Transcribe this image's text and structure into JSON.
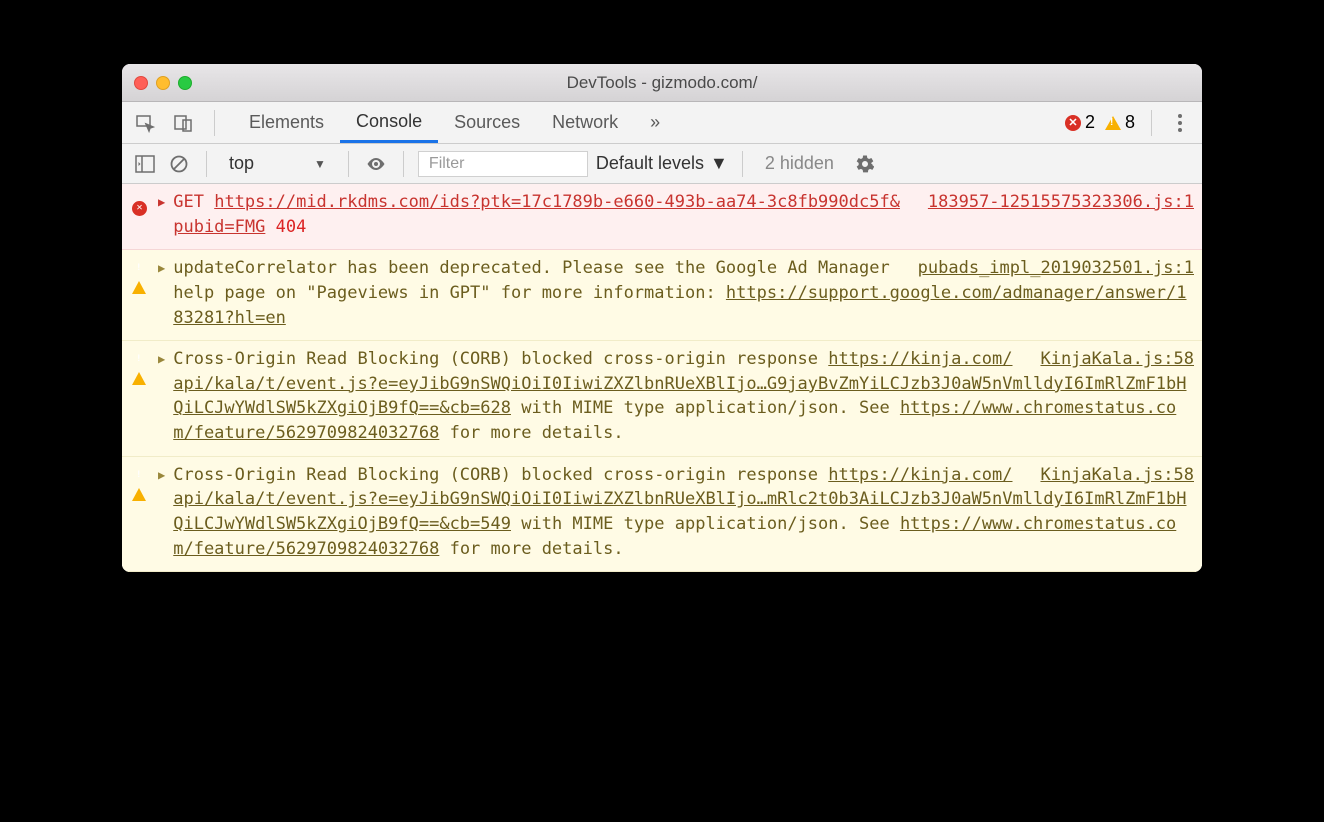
{
  "window": {
    "title": "DevTools - gizmodo.com/"
  },
  "tabs": {
    "items": [
      "Elements",
      "Console",
      "Sources",
      "Network"
    ],
    "active_index": 1,
    "error_count": "2",
    "warning_count": "8"
  },
  "toolbar": {
    "context": "top",
    "filter_placeholder": "Filter",
    "levels_label": "Default levels",
    "hidden_label": "2 hidden"
  },
  "messages": [
    {
      "type": "error",
      "method": "GET",
      "url": "https://mid.rkdms.com/ids?ptk=17c1789b-e660-493b-aa74-3c8fb990dc5f&pubid=FMG",
      "status": "404",
      "source": "183957-12515575323306.js:1"
    },
    {
      "type": "warning",
      "text_pre": "updateCorrelator has been deprecated. Please see the Google Ad Manager help page on \"Pageviews in GPT\" for more information: ",
      "link": "https://support.google.com/admanager/answer/183281?hl=en",
      "source": "pubads_impl_2019032501.js:1"
    },
    {
      "type": "warning",
      "text_pre": "Cross-Origin Read Blocking (CORB) blocked cross-origin response ",
      "link1": "https://kinja.com/api/kala/t/event.js?e=eyJibG9nSWQiOiI0IiwiZXZlbnRUeXBlIjo…G9jayBvZmYiLCJzb3J0aW5nVmlldyI6ImRlZmF1bHQiLCJwYWdlSW5kZXgiOjB9fQ==&cb=628",
      "text_mid": " with MIME type application/json. See ",
      "link2": "https://www.chromestatus.com/feature/5629709824032768",
      "text_post": " for more details.",
      "source": "KinjaKala.js:58"
    },
    {
      "type": "warning",
      "text_pre": "Cross-Origin Read Blocking (CORB) blocked cross-origin response ",
      "link1": "https://kinja.com/api/kala/t/event.js?e=eyJibG9nSWQiOiI0IiwiZXZlbnRUeXBlIjo…mRlc2t0b3AiLCJzb3J0aW5nVmlldyI6ImRlZmF1bHQiLCJwYWdlSW5kZXgiOjB9fQ==&cb=549",
      "text_mid": " with MIME type application/json. See ",
      "link2": "https://www.chromestatus.com/feature/5629709824032768",
      "text_post": " for more details.",
      "source": "KinjaKala.js:58"
    }
  ]
}
